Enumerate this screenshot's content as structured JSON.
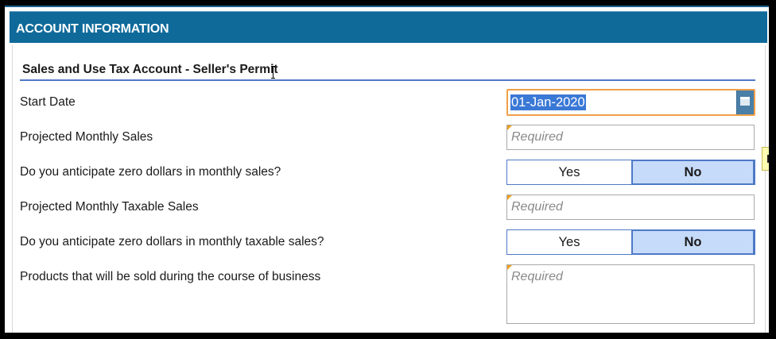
{
  "header": {
    "title": "ACCOUNT INFORMATION"
  },
  "section": {
    "title": "Sales and Use Tax Account - Seller's Permit"
  },
  "fields": {
    "start_date": {
      "label": "Start Date",
      "value": "01-Jan-2020",
      "icon": "calendar-icon"
    },
    "projected_monthly_sales": {
      "label": "Projected Monthly Sales",
      "placeholder": "Required"
    },
    "zero_monthly_sales": {
      "label": "Do you anticipate zero dollars in monthly sales?",
      "yes": "Yes",
      "no": "No",
      "selected": "No"
    },
    "projected_monthly_taxable_sales": {
      "label": "Projected Monthly Taxable Sales",
      "placeholder": "Required"
    },
    "zero_monthly_taxable_sales": {
      "label": "Do you anticipate zero dollars in monthly taxable sales?",
      "yes": "Yes",
      "no": "No",
      "selected": "No"
    },
    "products_sold": {
      "label": "Products that will be sold during the course of business",
      "placeholder": "Required"
    }
  },
  "tooltip": {
    "text": "F"
  },
  "colors": {
    "header_bg": "#0f6a9a",
    "section_rule": "#4f79c5",
    "selected_toggle": "#c6dbfa",
    "required_flag": "#f0a020",
    "focus_border": "#f0a04a"
  }
}
